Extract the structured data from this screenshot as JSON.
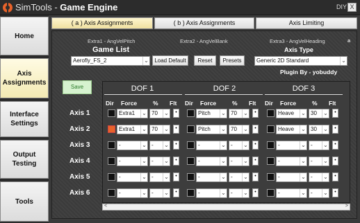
{
  "app": {
    "title_prefix": "SimTools - ",
    "title_bold": "Game Engine",
    "diy": "DIY",
    "close": "X"
  },
  "sidebar": {
    "items": [
      {
        "label": "Home"
      },
      {
        "label": "Axis Assignments",
        "active": true
      },
      {
        "label": "Interface Settings"
      },
      {
        "label": "Output Testing"
      },
      {
        "label": "Tools"
      }
    ]
  },
  "tabs": [
    {
      "label": "( a ) Axis Assignments",
      "active": true
    },
    {
      "label": "( b ) Axis Assignments"
    },
    {
      "label": "Axis Limiting"
    }
  ],
  "extras": {
    "e1": "Extra1 - AngVelPitch",
    "e2": "Extra2 - AngVelBank",
    "e3": "Extra3 - AngVelHeading",
    "corner": "a"
  },
  "game_list": {
    "label": "Game List",
    "value": "Aerofly_FS_2",
    "load_default": "Load Default",
    "reset": "Reset",
    "presets": "Presets"
  },
  "axis_type": {
    "label": "Axis Type",
    "value": "Generic 2D Standard"
  },
  "plugin": "Plugin By - yobuddy",
  "save": "Save",
  "dof_titles": [
    "DOF 1",
    "DOF 2",
    "DOF 3"
  ],
  "columns": {
    "dir": "Dir",
    "force": "Force",
    "pct": "%",
    "flt": "Flt"
  },
  "axes": [
    {
      "label": "Axis 1",
      "dof": [
        {
          "dir": false,
          "force": "Extra1",
          "pct": "70"
        },
        {
          "dir": false,
          "force": "Pitch",
          "pct": "70"
        },
        {
          "dir": false,
          "force": "Heave",
          "pct": "30"
        }
      ]
    },
    {
      "label": "Axis 2",
      "dof": [
        {
          "dir": true,
          "force": "Extra1",
          "pct": "70"
        },
        {
          "dir": false,
          "force": "Pitch",
          "pct": "70"
        },
        {
          "dir": false,
          "force": "Heave",
          "pct": "30"
        }
      ]
    },
    {
      "label": "Axis 3",
      "dof": [
        {
          "dir": false,
          "force": "-",
          "pct": "-"
        },
        {
          "dir": false,
          "force": "-",
          "pct": "-"
        },
        {
          "dir": false,
          "force": "-",
          "pct": "-"
        }
      ]
    },
    {
      "label": "Axis 4",
      "dof": [
        {
          "dir": false,
          "force": "-",
          "pct": "-"
        },
        {
          "dir": false,
          "force": "-",
          "pct": "-"
        },
        {
          "dir": false,
          "force": "-",
          "pct": "-"
        }
      ]
    },
    {
      "label": "Axis 5",
      "dof": [
        {
          "dir": false,
          "force": "-",
          "pct": "-"
        },
        {
          "dir": false,
          "force": "-",
          "pct": "-"
        },
        {
          "dir": false,
          "force": "-",
          "pct": "-"
        }
      ]
    },
    {
      "label": "Axis 6",
      "dof": [
        {
          "dir": false,
          "force": "-",
          "pct": "-"
        },
        {
          "dir": false,
          "force": "-",
          "pct": "-"
        },
        {
          "dir": false,
          "force": "-",
          "pct": "-"
        }
      ]
    }
  ],
  "flt_marker": "•",
  "scroll": {
    "left": "<",
    "right": ">"
  },
  "colors": {
    "accent": "#f3eab3",
    "dir_on": "#e8622a",
    "logo": "#e8622a"
  }
}
